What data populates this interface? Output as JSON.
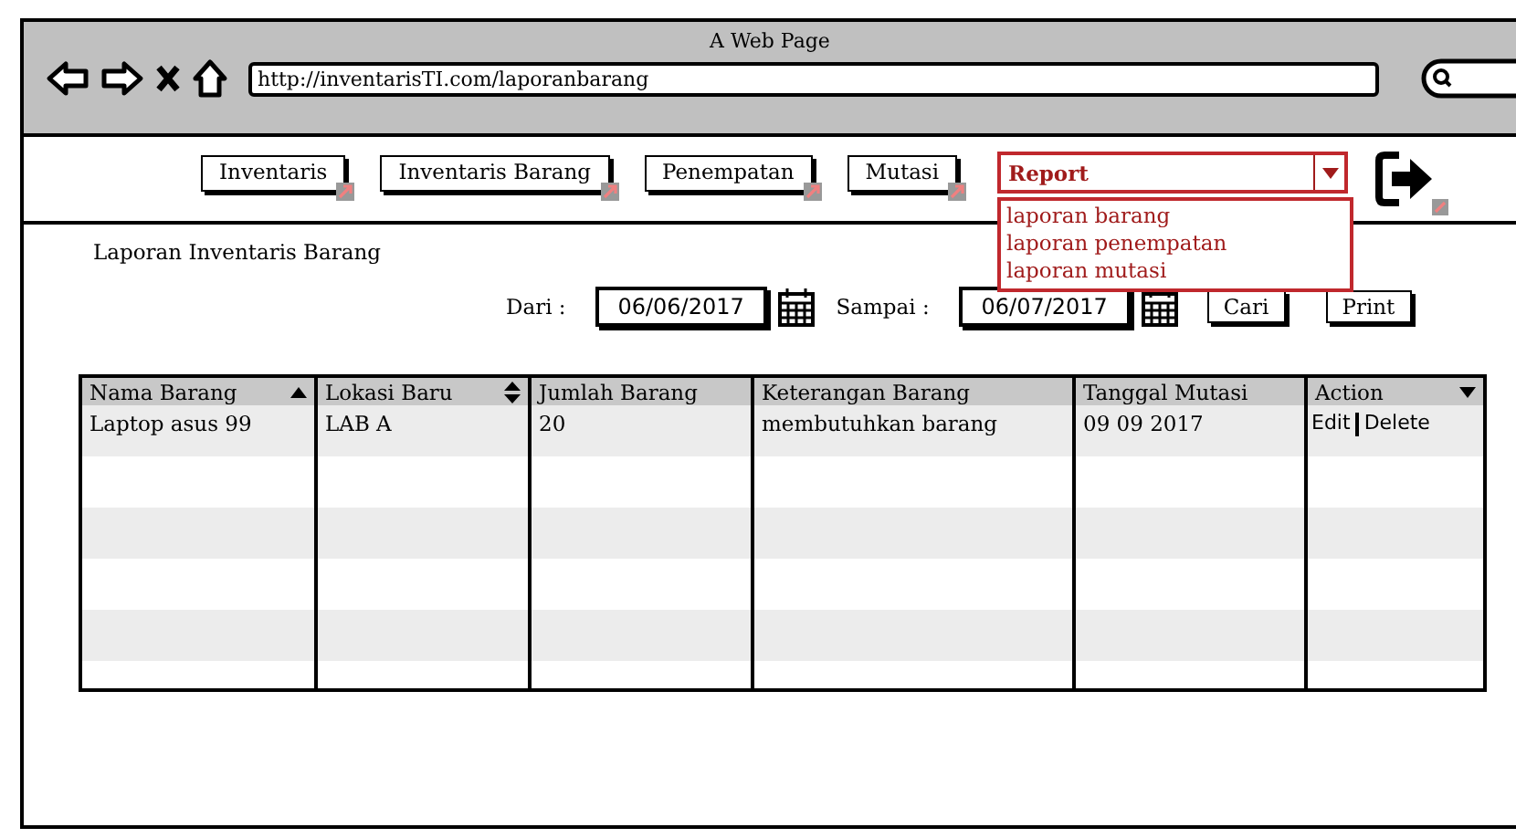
{
  "window": {
    "title": "A Web Page",
    "url": "http://inventarisTI.com/laporanbarang"
  },
  "nav": [
    {
      "label": "Inventaris"
    },
    {
      "label": "Inventaris Barang"
    },
    {
      "label": "Penempatan"
    },
    {
      "label": "Mutasi"
    }
  ],
  "report_dropdown": {
    "value": "Report",
    "expanded": true,
    "options": [
      "laporan barang",
      "laporan penempatan",
      "laporan mutasi"
    ]
  },
  "page_title": "Laporan Inventaris Barang",
  "filter": {
    "from_label": "Dari :",
    "from_value": "06/06/2017",
    "to_label": "Sampai :",
    "to_value": "06/07/2017",
    "buttons": [
      "Cari",
      "Print"
    ]
  },
  "table": {
    "columns": [
      {
        "label": "Nama Barang",
        "kind": "asc"
      },
      {
        "label": "Lokasi Baru",
        "kind": "both"
      },
      {
        "label": "Jumlah Barang",
        "kind": "plain"
      },
      {
        "label": "Keterangan Barang",
        "kind": "plain"
      },
      {
        "label": "Tanggal Mutasi",
        "kind": "plain"
      },
      {
        "label": "Action",
        "kind": "desc"
      }
    ],
    "rows": [
      {
        "cells": [
          "Laptop asus 99",
          "LAB A",
          "20",
          "membutuhkan barang",
          "09 09 2017"
        ],
        "actions": [
          "Edit",
          "Delete"
        ]
      }
    ]
  }
}
